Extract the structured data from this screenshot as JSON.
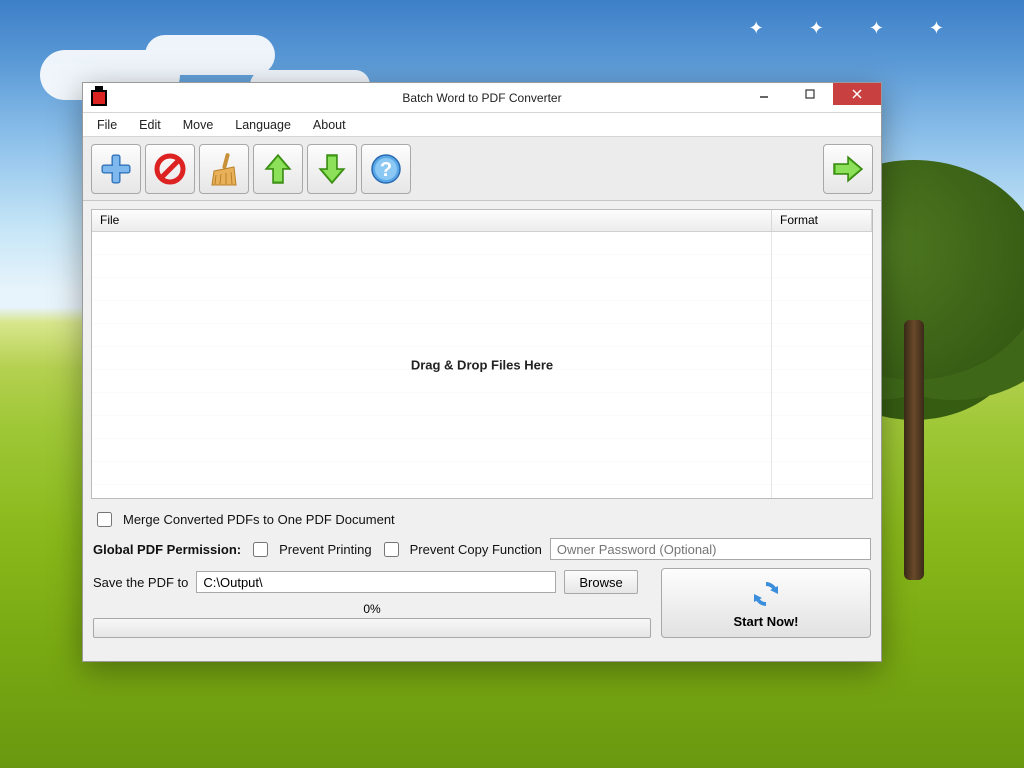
{
  "window": {
    "title": "Batch Word to PDF Converter"
  },
  "menu": {
    "items": [
      "File",
      "Edit",
      "Move",
      "Language",
      "About"
    ]
  },
  "toolbar": {
    "add": "add-icon",
    "remove": "remove-icon",
    "clear": "broom-icon",
    "up": "arrow-up-icon",
    "down": "arrow-down-icon",
    "help": "help-icon",
    "go": "arrow-right-icon"
  },
  "table": {
    "columns": {
      "file": "File",
      "format": "Format"
    },
    "drop_hint": "Drag & Drop Files Here"
  },
  "options": {
    "merge_label": "Merge Converted PDFs to One PDF Document",
    "perm_label": "Global PDF Permission:",
    "prevent_print": "Prevent Printing",
    "prevent_copy": "Prevent Copy Function",
    "owner_pass_placeholder": "Owner Password (Optional)",
    "save_label": "Save the PDF to",
    "save_path": "C:\\Output\\",
    "browse": "Browse",
    "progress": "0%",
    "start": "Start Now!"
  }
}
